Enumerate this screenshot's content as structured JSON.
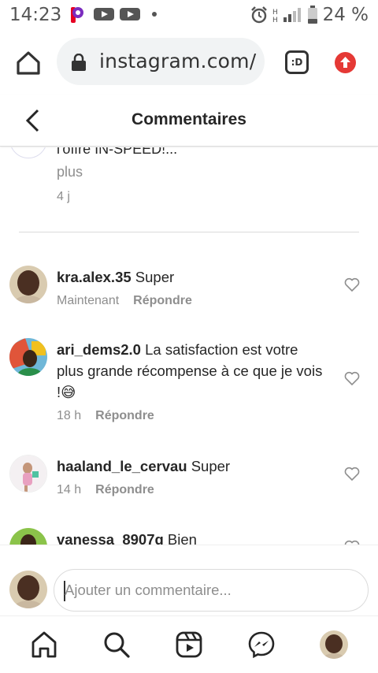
{
  "status_bar": {
    "time": "14:23",
    "battery": "24 %"
  },
  "browser": {
    "url": "instagram.com/",
    "tabs_label": ":D"
  },
  "header": {
    "title": "Commentaires"
  },
  "caption": {
    "text": "l'offre IN-SPEED!...",
    "more": "plus",
    "time": "4 j"
  },
  "comments": [
    {
      "username": "kra.alex.35",
      "text": "Super",
      "time": "Maintenant",
      "reply": "Répondre"
    },
    {
      "username": "ari_dems2.0",
      "text": "La satisfaction est votre plus grande récompense à ce que je vois !😅",
      "time": "18 h",
      "reply": "Répondre"
    },
    {
      "username": "haaland_le_cervau",
      "text": "Super",
      "time": "14 h",
      "reply": "Répondre"
    },
    {
      "username": "vanessa_8907q",
      "text": "Bien",
      "time": "",
      "reply": ""
    }
  ],
  "add_comment": {
    "placeholder": "Ajouter un commentaire..."
  },
  "colors": {
    "text": "#262626",
    "secondary": "#8e8e8e",
    "divider": "#dbdbdb",
    "accent_red": "#e53935",
    "pinterest": "#e60023"
  },
  "icons": {
    "status": [
      "pinterest-icon",
      "youtube-icon",
      "youtube-icon",
      "dot-icon",
      "alarm-icon",
      "signal-icon",
      "battery-icon"
    ],
    "browser": [
      "home-icon",
      "lock-icon",
      "tabs-icon",
      "upload-icon"
    ],
    "nav": [
      "home-icon",
      "search-icon",
      "reels-icon",
      "messenger-icon",
      "profile-avatar"
    ]
  }
}
